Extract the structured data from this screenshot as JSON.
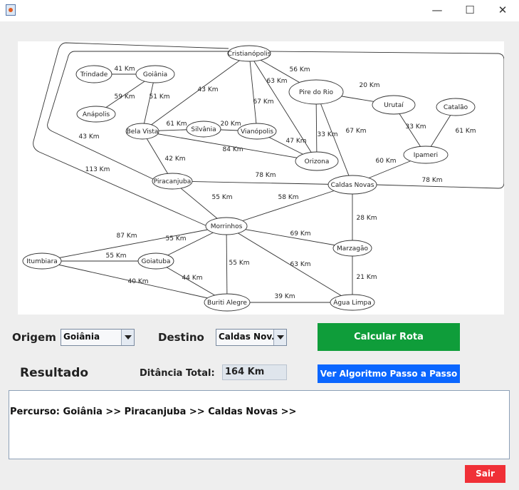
{
  "window": {
    "minimize_glyph": "—",
    "maximize_glyph": "☐",
    "close_glyph": "✕"
  },
  "graph": {
    "nodes": [
      {
        "id": "cristianopolis",
        "label": "Cristianópolis"
      },
      {
        "id": "trindade",
        "label": "Trindade"
      },
      {
        "id": "goiania",
        "label": "Goiânia"
      },
      {
        "id": "anapolis",
        "label": "Anápolis"
      },
      {
        "id": "piredorio",
        "label": "Pire do Rio"
      },
      {
        "id": "urutai",
        "label": "Urutaí"
      },
      {
        "id": "catalao",
        "label": "Catalão"
      },
      {
        "id": "belavista",
        "label": "Bela Vista"
      },
      {
        "id": "silvania",
        "label": "Silvânia"
      },
      {
        "id": "vianopolis",
        "label": "Vianópolis"
      },
      {
        "id": "ipameri",
        "label": "Ipameri"
      },
      {
        "id": "orizona",
        "label": "Orizona"
      },
      {
        "id": "piracanjuba",
        "label": "Piracanjuba"
      },
      {
        "id": "caldasnovas",
        "label": "Caldas Novas"
      },
      {
        "id": "morrinhos",
        "label": "Morrinhos"
      },
      {
        "id": "itumbiara",
        "label": "Itumbiara"
      },
      {
        "id": "goiatuba",
        "label": "Goiatuba"
      },
      {
        "id": "marzagao",
        "label": "Marzagão"
      },
      {
        "id": "buritialegre",
        "label": "Buriti Alegre"
      },
      {
        "id": "agualimpa",
        "label": "Água Limpa"
      }
    ],
    "edges": [
      {
        "from": "trindade",
        "to": "goiania",
        "label": "41 Km"
      },
      {
        "from": "goiania",
        "to": "anapolis",
        "label": "59 Km"
      },
      {
        "from": "goiania",
        "to": "belavista",
        "label": "51 Km"
      },
      {
        "from": "cristianopolis",
        "to": "belavista",
        "label": "43 Km"
      },
      {
        "from": "cristianopolis",
        "to": "vianopolis",
        "label": "67 Km"
      },
      {
        "from": "cristianopolis",
        "to": "orizona",
        "label": "63 Km"
      },
      {
        "from": "cristianopolis",
        "to": "piredorio",
        "label": "56 Km"
      },
      {
        "from": "piredorio",
        "to": "urutai",
        "label": "20 Km"
      },
      {
        "from": "piredorio",
        "to": "orizona",
        "label": "33 Km"
      },
      {
        "from": "piredorio",
        "to": "caldasnovas",
        "label": "67 Km"
      },
      {
        "from": "urutai",
        "to": "ipameri",
        "label": "33 Km"
      },
      {
        "from": "catalao",
        "to": "ipameri",
        "label": "61 Km"
      },
      {
        "from": "ipameri",
        "to": "caldasnovas",
        "label": "60 Km"
      },
      {
        "from": "belavista",
        "to": "silvania",
        "label": "61 Km"
      },
      {
        "from": "silvania",
        "to": "vianopolis",
        "label": "20 Km"
      },
      {
        "from": "vianopolis",
        "to": "orizona",
        "label": "47 Km"
      },
      {
        "from": "belavista",
        "to": "orizona",
        "label": "84 Km"
      },
      {
        "from": "belavista",
        "to": "piracanjuba",
        "label": "42 Km"
      },
      {
        "from": "piracanjuba",
        "to": "caldasnovas",
        "label": "78 Km"
      },
      {
        "from": "piracanjuba",
        "to": "morrinhos",
        "label": "55 Km"
      },
      {
        "from": "caldasnovas",
        "to": "morrinhos",
        "label": "58 Km"
      },
      {
        "from": "caldasnovas",
        "to": "marzagao",
        "label": "28 Km"
      },
      {
        "from": "morrinhos",
        "to": "goiatuba",
        "label": "55 Km"
      },
      {
        "from": "morrinhos",
        "to": "itumbiara",
        "label": "87 Km"
      },
      {
        "from": "morrinhos",
        "to": "marzagao",
        "label": "69 Km"
      },
      {
        "from": "morrinhos",
        "to": "buritialegre",
        "label": "55 Km"
      },
      {
        "from": "morrinhos",
        "to": "agualimpa",
        "label": "63 Km"
      },
      {
        "from": "itumbiara",
        "to": "goiatuba",
        "label": "55 Km"
      },
      {
        "from": "itumbiara",
        "to": "buritialegre",
        "label": "40 Km"
      },
      {
        "from": "goiatuba",
        "to": "buritialegre",
        "label": "44 Km"
      },
      {
        "from": "buritialegre",
        "to": "agualimpa",
        "label": "39 Km"
      },
      {
        "from": "marzagao",
        "to": "agualimpa",
        "label": "21 Km"
      },
      {
        "from": "cristianopolis",
        "to": "piracanjuba",
        "label": "43 Km"
      },
      {
        "from": "cristianopolis",
        "to": "morrinhos",
        "label": "113 Km"
      },
      {
        "from": "cristianopolis",
        "to": "caldasnovas",
        "label": "78 Km"
      }
    ]
  },
  "controls": {
    "origem_label": "Origem",
    "origem_value": "Goiânia",
    "destino_label": "Destino",
    "destino_value": "Caldas Nov...",
    "calcular_button": "Calcular Rota",
    "resultado_label": "Resultado",
    "distancia_label": "Ditância Total:",
    "distancia_value": "164 Km",
    "passo_button": "Ver Algoritmo Passo a Passo",
    "percurso_text": "Percurso: Goiânia >> Piracanjuba >> Caldas Novas >>",
    "sair_button": "Sair"
  },
  "colors": {
    "calcular_bg": "#0f9d3a",
    "passo_bg": "#0a66ff",
    "sair_bg": "#f03037"
  }
}
